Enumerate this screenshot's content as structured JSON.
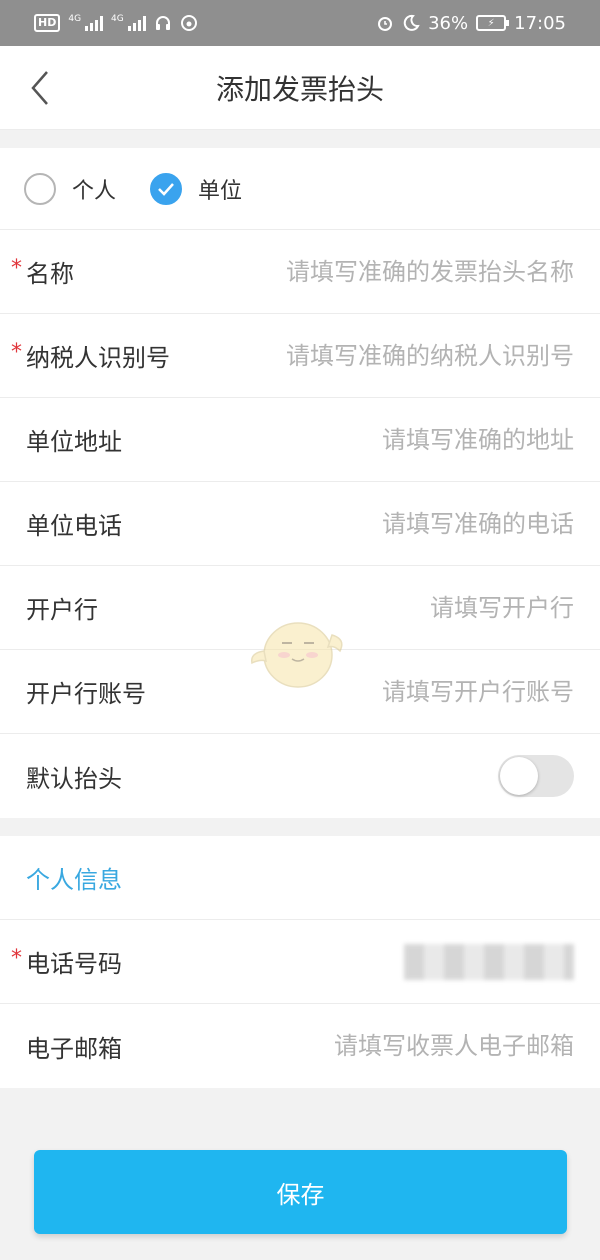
{
  "status_bar": {
    "hd": "HD",
    "net1": "4G",
    "net2": "4G",
    "battery_pct": "36%",
    "time": "17:05"
  },
  "nav": {
    "title": "添加发票抬头"
  },
  "invoice_type": {
    "options": [
      {
        "label": "个人",
        "checked": false
      },
      {
        "label": "单位",
        "checked": true
      }
    ]
  },
  "fields": {
    "name": {
      "label": "名称",
      "placeholder": "请填写准确的发票抬头名称"
    },
    "tax_id": {
      "label": "纳税人识别号",
      "placeholder": "请填写准确的纳税人识别号"
    },
    "address": {
      "label": "单位地址",
      "placeholder": "请填写准确的地址"
    },
    "phone": {
      "label": "单位电话",
      "placeholder": "请填写准确的电话"
    },
    "bank": {
      "label": "开户行",
      "placeholder": "请填写开户行"
    },
    "bank_account": {
      "label": "开户行账号",
      "placeholder": "请填写开户行账号"
    },
    "default_header": {
      "label": "默认抬头",
      "enabled": false
    }
  },
  "personal": {
    "section_title": "个人信息",
    "phone": {
      "label": "电话号码"
    },
    "email": {
      "label": "电子邮箱",
      "placeholder": "请填写收票人电子邮箱"
    }
  },
  "required_mark": "*",
  "save_label": "保存",
  "colors": {
    "accent": "#1fb6f0",
    "section_text": "#39a8e0",
    "required": "#e0353b",
    "radio_checked": "#3aa3ee"
  }
}
